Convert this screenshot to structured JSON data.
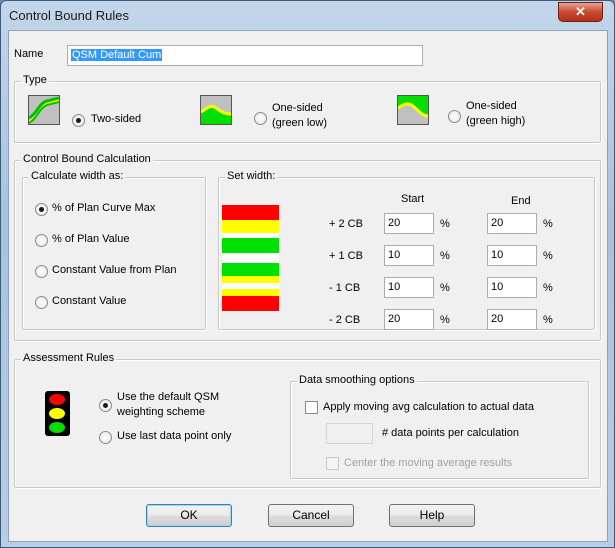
{
  "window": {
    "title": "Control Bound Rules",
    "close_glyph": "✕"
  },
  "name_field": {
    "label": "Name",
    "value": "QSM Default Cum"
  },
  "type_group": {
    "title": "Type",
    "options": [
      {
        "label": "Two-sided",
        "checked": true,
        "icon": "two-sided-band-icon"
      },
      {
        "label_line1": "One-sided",
        "label_line2": "(green low)",
        "checked": false,
        "icon": "one-sided-green-low-icon"
      },
      {
        "label_line1": "One-sided",
        "label_line2": "(green high)",
        "checked": false,
        "icon": "one-sided-green-high-icon"
      }
    ]
  },
  "calc_group": {
    "title": "Control Bound Calculation",
    "width_as": {
      "title": "Calculate width as:",
      "options": [
        {
          "label": "% of Plan Curve Max",
          "checked": true
        },
        {
          "label": "% of Plan Value",
          "checked": false
        },
        {
          "label": "Constant Value from Plan",
          "checked": false
        },
        {
          "label": "Constant Value",
          "checked": false
        }
      ]
    },
    "set_width": {
      "title": "Set width:",
      "start_header": "Start",
      "end_header": "End",
      "unit": "%",
      "rows": [
        {
          "label": "+ 2 CB",
          "start": "20",
          "end": "20"
        },
        {
          "label": "+ 1 CB",
          "start": "10",
          "end": "10"
        },
        {
          "label": "- 1 CB",
          "start": "10",
          "end": "10"
        },
        {
          "label": "- 2 CB",
          "start": "20",
          "end": "20"
        }
      ]
    },
    "band_colors": {
      "red": "#ff0000",
      "yellow": "#ffff00",
      "green": "#00e000"
    }
  },
  "assessment": {
    "title": "Assessment Rules",
    "option_default_line1": "Use the default QSM",
    "option_default_line2": "weighting scheme",
    "option_default_checked": true,
    "option_last": "Use last data point only",
    "option_last_checked": false,
    "smoothing": {
      "title": "Data smoothing options",
      "apply_label": "Apply moving avg calculation to actual data",
      "apply_checked": false,
      "points_value": "",
      "points_label": "# data points per calculation",
      "center_label": "Center the moving average results",
      "center_checked": false
    }
  },
  "buttons": {
    "ok": "OK",
    "cancel": "Cancel",
    "help": "Help"
  }
}
